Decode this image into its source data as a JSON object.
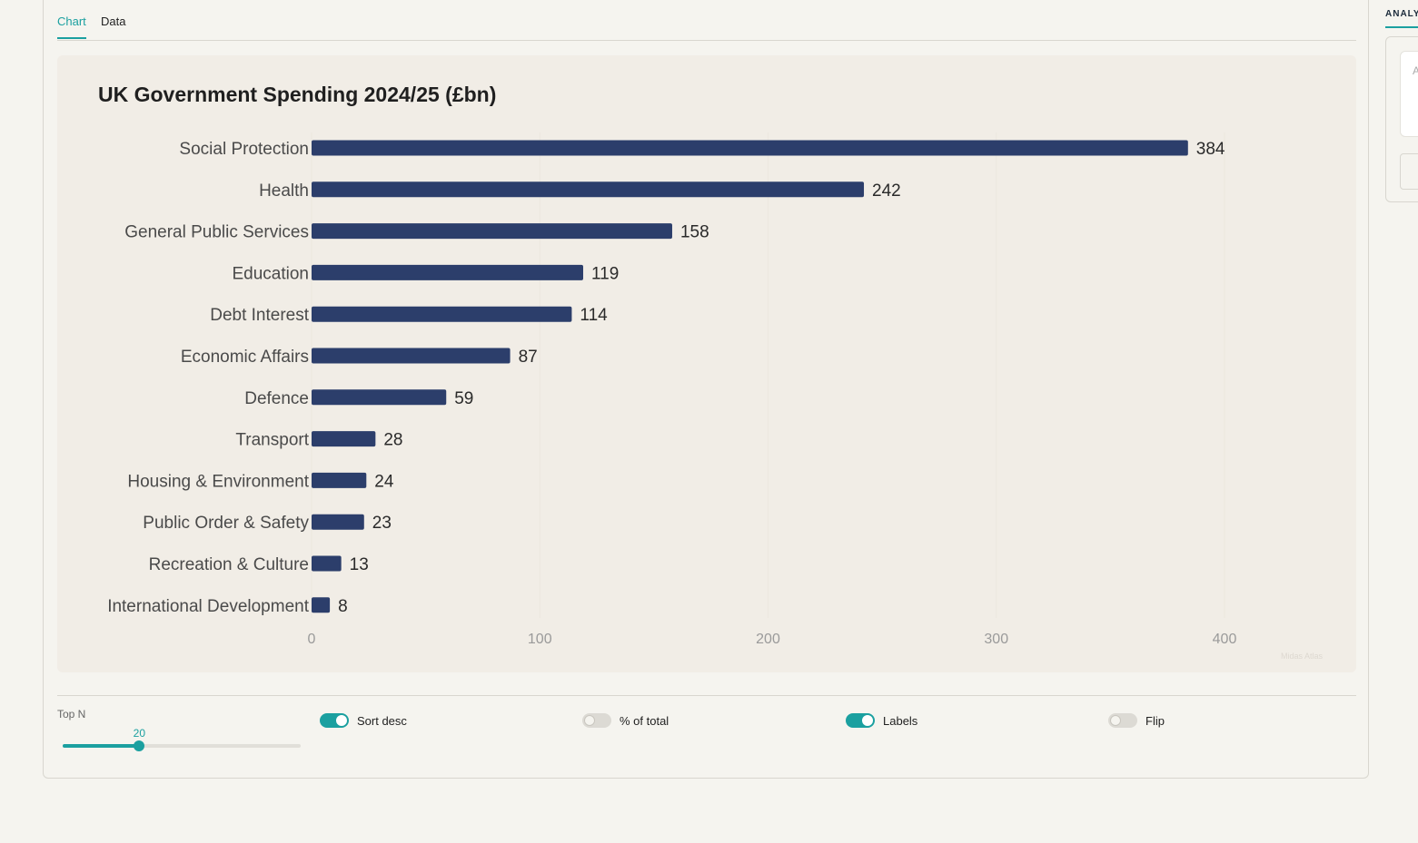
{
  "tabs": [
    {
      "label": "Chart",
      "active": true
    },
    {
      "label": "Data",
      "active": false
    }
  ],
  "chart_data": {
    "type": "bar",
    "orientation": "horizontal",
    "title": "UK Government Spending 2024/25 (£bn)",
    "categories": [
      "Social Protection",
      "Health",
      "General Public Services",
      "Education",
      "Debt Interest",
      "Economic Affairs",
      "Defence",
      "Transport",
      "Housing & Environment",
      "Public Order & Safety",
      "Recreation & Culture",
      "International Development"
    ],
    "values": [
      384,
      242,
      158,
      119,
      114,
      87,
      59,
      28,
      24,
      23,
      13,
      8
    ],
    "xlim": [
      0,
      400
    ],
    "xticks": [
      0,
      100,
      200,
      300,
      400
    ],
    "data_labels": true,
    "grid": false,
    "bar_color": "#2c3e6b"
  },
  "watermark": "Midas Atlas",
  "controls": {
    "top_n": {
      "label": "Top N",
      "value": 20,
      "min": 1,
      "max": 60
    },
    "toggles": [
      {
        "label": "Sort desc",
        "on": true
      },
      {
        "label": "% of total",
        "on": false
      },
      {
        "label": "Labels",
        "on": true
      },
      {
        "label": "Flip",
        "on": false
      }
    ]
  },
  "sidebar": {
    "heading": "ANALY",
    "textarea_placeholder": "A"
  },
  "colors": {
    "accent": "#1ba0a0",
    "bar": "#2c3e6b",
    "chart_background": "#f1ede6"
  }
}
